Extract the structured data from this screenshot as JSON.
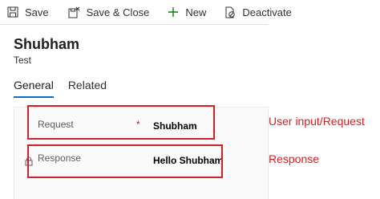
{
  "command_bar": {
    "save_label": "Save",
    "save_close_label": "Save & Close",
    "new_label": "New",
    "deactivate_label": "Deactivate"
  },
  "header": {
    "title": "Shubham",
    "subtitle": "Test"
  },
  "tabs": [
    {
      "label": "General",
      "active": true
    },
    {
      "label": "Related",
      "active": false
    }
  ],
  "form": {
    "request": {
      "label": "Request",
      "required_marker": "*",
      "value": "Shubham"
    },
    "response": {
      "label": "Response",
      "value": "Hello Shubham",
      "locked": true
    }
  },
  "annotations": {
    "request_note": "User input/Request",
    "response_note": "Response",
    "color": "#d41f25"
  },
  "colors": {
    "accent": "#0f6cbd",
    "new_icon": "#107c10",
    "required": "#a4262c"
  }
}
